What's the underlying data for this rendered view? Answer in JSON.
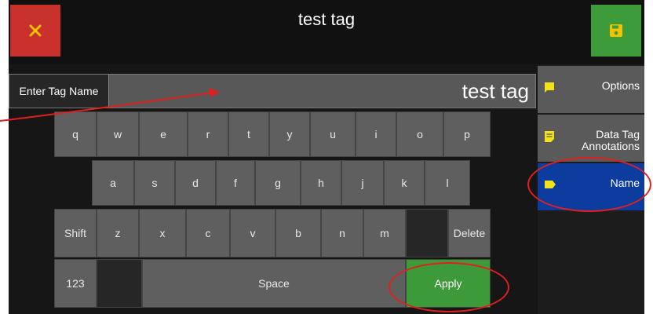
{
  "header": {
    "title": "test tag"
  },
  "input": {
    "label": "Enter Tag Name",
    "value": "test tag"
  },
  "keyboard": {
    "row1": [
      "q",
      "w",
      "e",
      "r",
      "t",
      "y",
      "u",
      "i",
      "o",
      "p"
    ],
    "row2": [
      "a",
      "s",
      "d",
      "f",
      "g",
      "h",
      "j",
      "k",
      "l"
    ],
    "row3": [
      "Shift",
      "z",
      "x",
      "c",
      "v",
      "b",
      "n",
      "m",
      "Delete"
    ],
    "row4": {
      "numbers": "123",
      "space": "Space",
      "apply": "Apply"
    }
  },
  "sidebar": {
    "items": [
      {
        "label": "Options",
        "icon": "comment-icon"
      },
      {
        "label": "Data Tag Annotations",
        "icon": "note-icon"
      },
      {
        "label": "Name",
        "icon": "tag-icon",
        "active": true
      }
    ]
  },
  "colors": {
    "close": "#c8312c",
    "save": "#3e9b3a",
    "active": "#0c3d9e",
    "annotation": "#e0201e",
    "icon": "#f2e21a"
  }
}
